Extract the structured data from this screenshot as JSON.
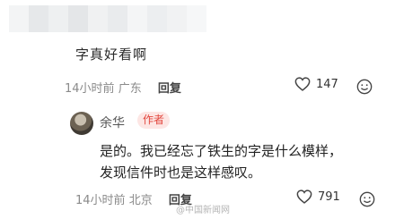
{
  "comment_1": {
    "text": "字真好看啊",
    "time": "14小时前",
    "location": "广东",
    "reply_label": "回复",
    "likes": "147"
  },
  "comment_2": {
    "author": "余华",
    "badge": "作者",
    "lines": [
      "是的。我已经忘了铁生的字是什么模样，",
      "发现信件时也是这样感叹。"
    ],
    "time": "14小时前",
    "location": "北京",
    "reply_label": "回复",
    "likes": "791"
  },
  "watermark": "@中国新闻网",
  "colors": {
    "badge_text": "#e2473e",
    "badge_bg": "#fde6e4",
    "meta_gray": "#8a8a8a"
  },
  "icons": [
    "heart-icon",
    "emoji-icon"
  ]
}
